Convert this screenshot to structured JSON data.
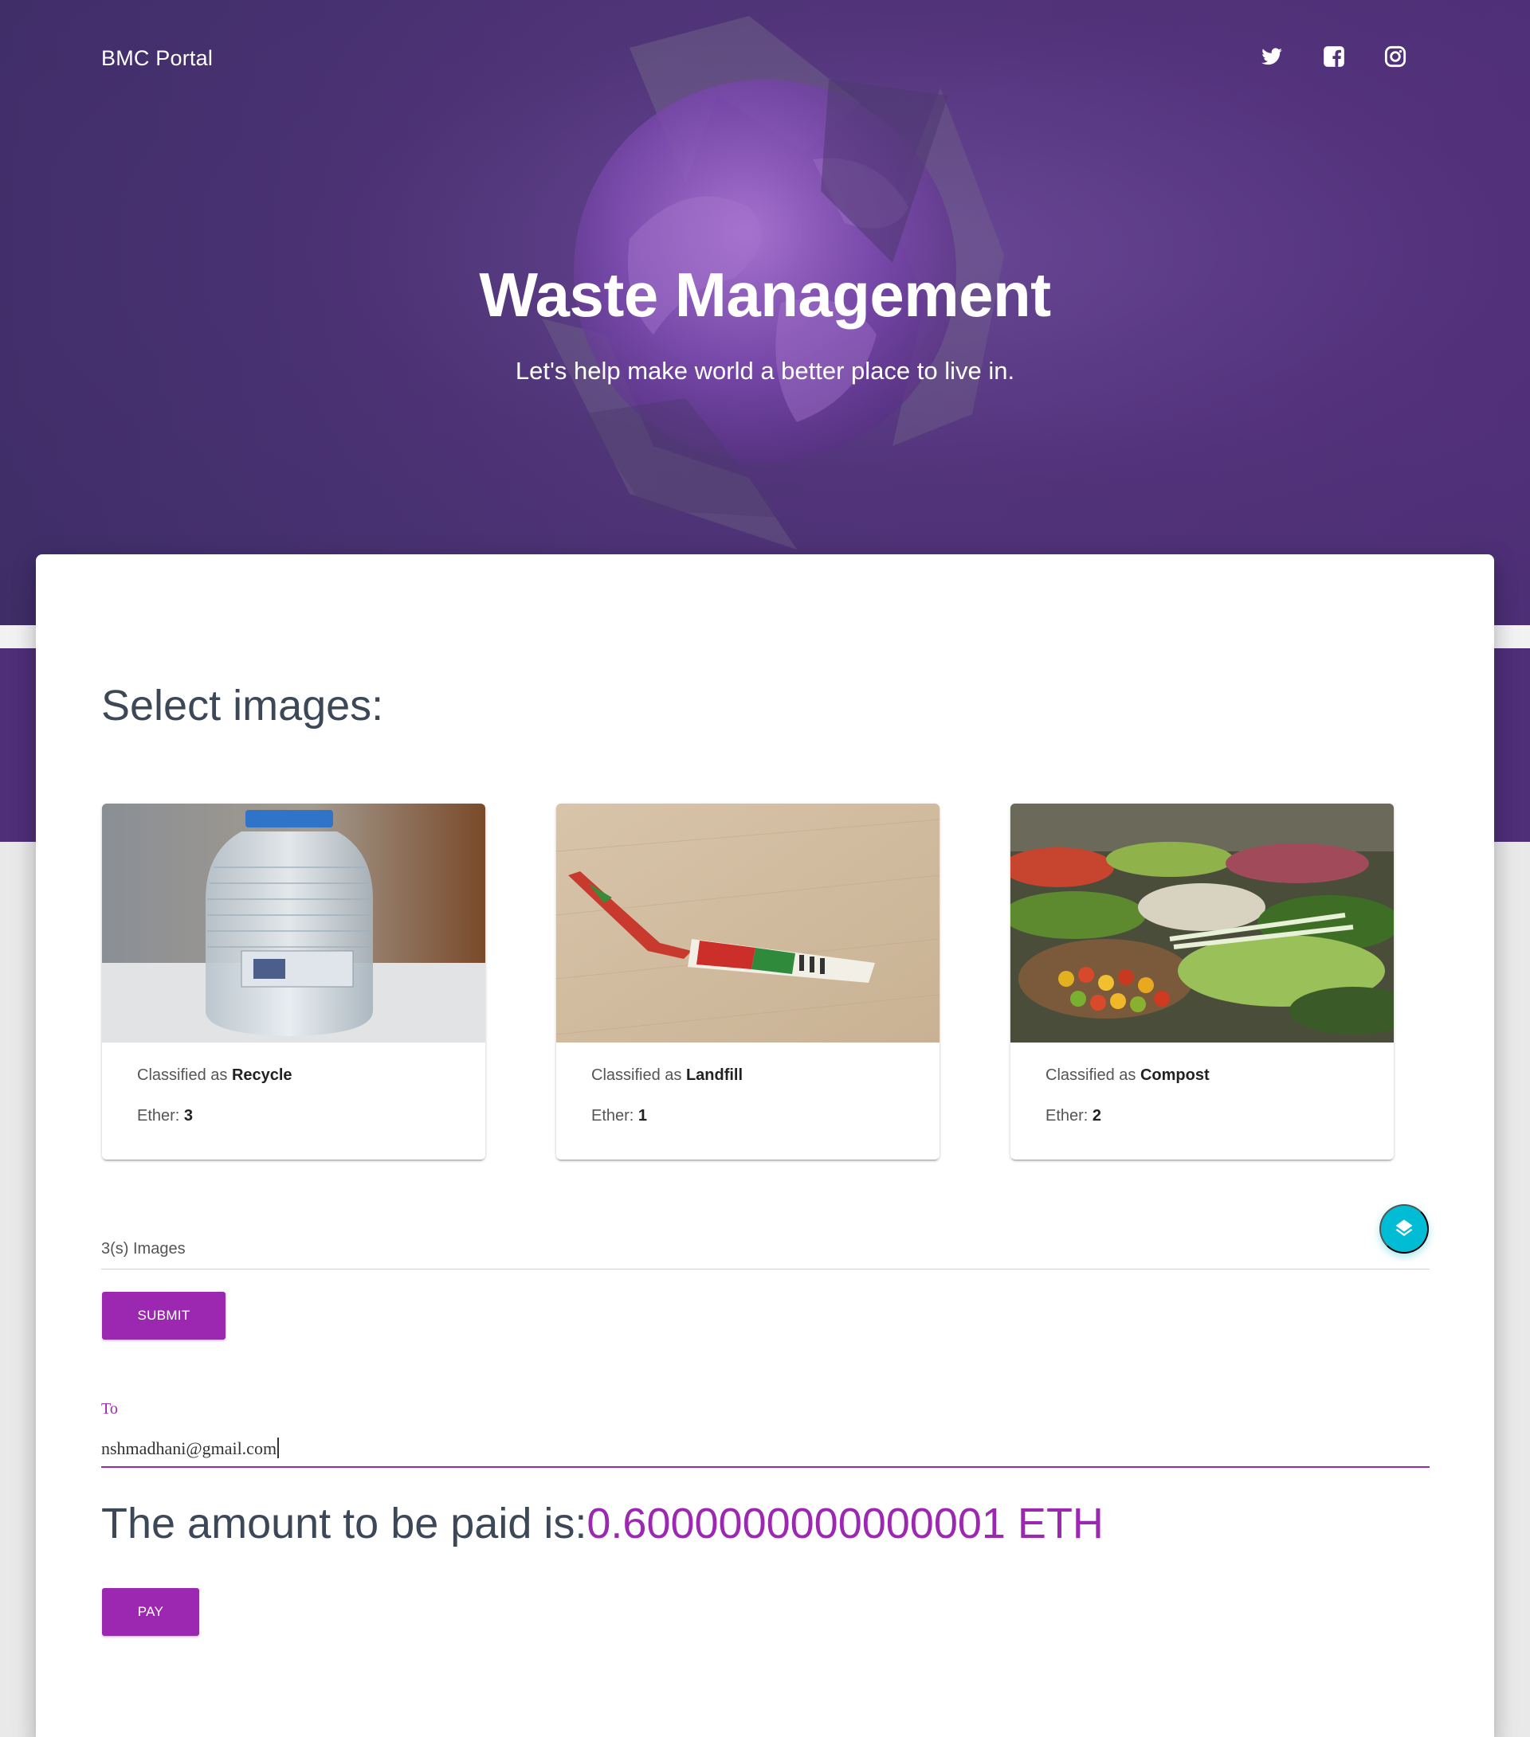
{
  "header": {
    "brand": "BMC Portal",
    "title": "Waste Management",
    "subtitle": "Let's help make world a better place to live in.",
    "social": [
      "twitter-icon",
      "facebook-icon",
      "instagram-icon"
    ]
  },
  "main": {
    "section_title": "Select images:",
    "cards": [
      {
        "classified_prefix": "Classified as ",
        "classification": "Recycle",
        "ether_prefix": "Ether: ",
        "ether": "3"
      },
      {
        "classified_prefix": "Classified as ",
        "classification": "Landfill",
        "ether_prefix": "Ether: ",
        "ether": "1"
      },
      {
        "classified_prefix": "Classified as ",
        "classification": "Compost",
        "ether_prefix": "Ether: ",
        "ether": "2"
      }
    ],
    "file_count": "3(s) Images",
    "submit_label": "SUBMIT",
    "to_label": "To",
    "to_value": "nshmadhani@gmail.com",
    "amount_prefix": "The amount to be paid is:",
    "amount_value": "0.6000000000000001 ETH",
    "pay_label": "PAY"
  },
  "colors": {
    "primary": "#9c27b0",
    "fab": "#00bcd4",
    "hero": "#503478"
  }
}
